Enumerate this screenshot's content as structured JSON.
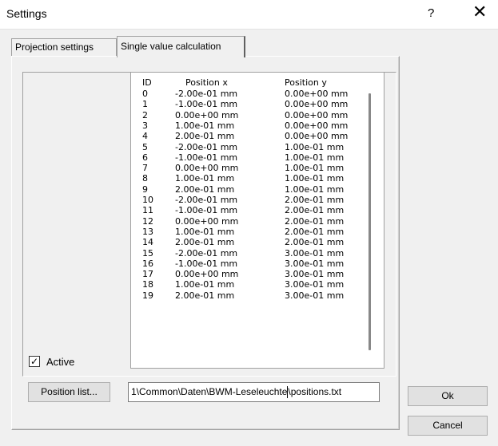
{
  "window": {
    "title": "Settings",
    "help_glyph": "?",
    "close_glyph": "✕"
  },
  "tabs": [
    {
      "label": "Projection settings",
      "active": false
    },
    {
      "label": "Single value calculation",
      "active": true
    }
  ],
  "list": {
    "headers": {
      "id": "ID",
      "x": "Position x",
      "y": "Position y"
    },
    "rows": [
      {
        "id": "0",
        "x": "-2.00e-01 mm",
        "y": "0.00e+00 mm"
      },
      {
        "id": "1",
        "x": "-1.00e-01 mm",
        "y": "0.00e+00 mm"
      },
      {
        "id": "2",
        "x": "0.00e+00 mm",
        "y": "0.00e+00 mm"
      },
      {
        "id": "3",
        "x": "1.00e-01 mm",
        "y": "0.00e+00 mm"
      },
      {
        "id": "4",
        "x": "2.00e-01 mm",
        "y": "0.00e+00 mm"
      },
      {
        "id": "5",
        "x": "-2.00e-01 mm",
        "y": "1.00e-01 mm"
      },
      {
        "id": "6",
        "x": "-1.00e-01 mm",
        "y": "1.00e-01 mm"
      },
      {
        "id": "7",
        "x": "0.00e+00 mm",
        "y": "1.00e-01 mm"
      },
      {
        "id": "8",
        "x": "1.00e-01 mm",
        "y": "1.00e-01 mm"
      },
      {
        "id": "9",
        "x": "2.00e-01 mm",
        "y": "1.00e-01 mm"
      },
      {
        "id": "10",
        "x": "-2.00e-01 mm",
        "y": "2.00e-01 mm"
      },
      {
        "id": "11",
        "x": "-1.00e-01 mm",
        "y": "2.00e-01 mm"
      },
      {
        "id": "12",
        "x": "0.00e+00 mm",
        "y": "2.00e-01 mm"
      },
      {
        "id": "13",
        "x": "1.00e-01 mm",
        "y": "2.00e-01 mm"
      },
      {
        "id": "14",
        "x": "2.00e-01 mm",
        "y": "2.00e-01 mm"
      },
      {
        "id": "15",
        "x": "-2.00e-01 mm",
        "y": "3.00e-01 mm"
      },
      {
        "id": "16",
        "x": "-1.00e-01 mm",
        "y": "3.00e-01 mm"
      },
      {
        "id": "17",
        "x": "0.00e+00 mm",
        "y": "3.00e-01 mm"
      },
      {
        "id": "18",
        "x": "1.00e-01 mm",
        "y": "3.00e-01 mm"
      },
      {
        "id": "19",
        "x": "2.00e-01 mm",
        "y": "3.00e-01 mm"
      }
    ]
  },
  "active_checkbox": {
    "label": "Active",
    "checked": true,
    "check_glyph": "✓"
  },
  "position_list_button": "Position list...",
  "path_field": {
    "value_before_caret": "1\\Common\\Daten\\BWM-Leseleuchte",
    "value_after_caret": "\\positions.txt"
  },
  "buttons": {
    "ok": "Ok",
    "cancel": "Cancel"
  }
}
